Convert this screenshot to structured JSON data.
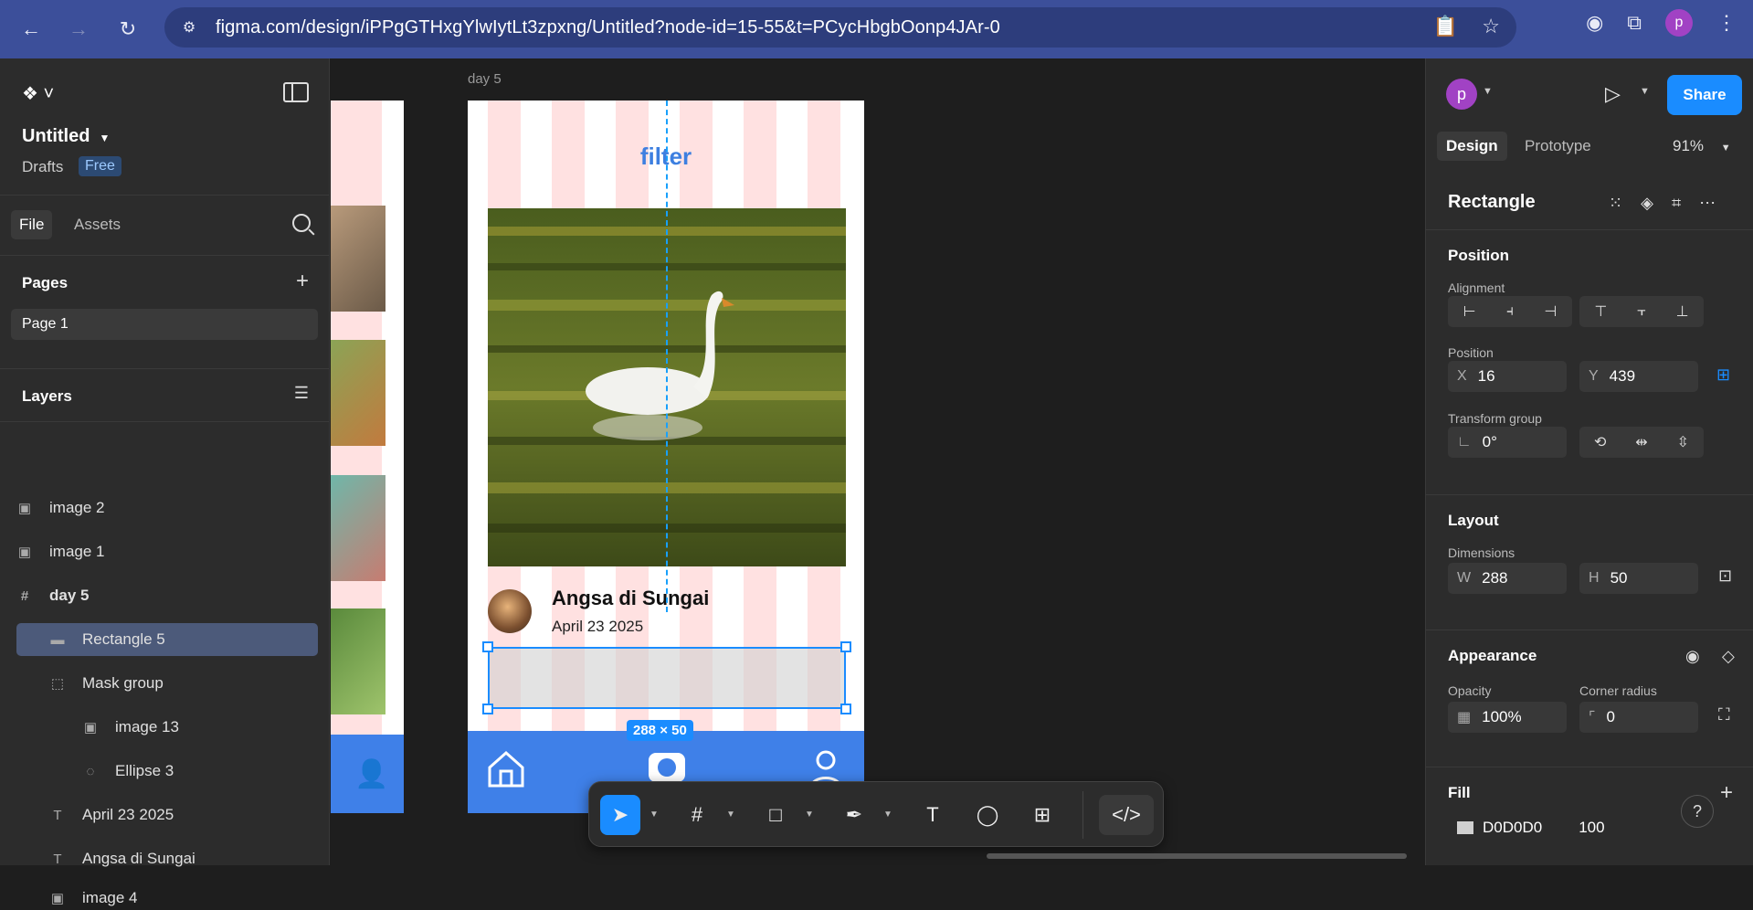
{
  "browser": {
    "url": "figma.com/design/iPPgGTHxgYlwIytLt3zpxng/Untitled?node-id=15-55&t=PCycHbgbOonp4JAr-0",
    "profile_initial": "p"
  },
  "left_panel": {
    "file_title": "Untitled",
    "drafts_label": "Drafts",
    "plan_badge": "Free",
    "tabs": [
      "File",
      "Assets"
    ],
    "pages_heading": "Pages",
    "pages": [
      "Page 1"
    ],
    "layers_heading": "Layers",
    "layers": [
      {
        "name": "image 2",
        "icon": "image-icon"
      },
      {
        "name": "image 1",
        "icon": "image-icon"
      },
      {
        "name": "day 5",
        "icon": "frame-icon"
      },
      {
        "name": "Rectangle 5",
        "icon": "rectangle-icon",
        "selected": true
      },
      {
        "name": "Mask group",
        "icon": "mask-icon"
      },
      {
        "name": "image 13",
        "icon": "image-icon"
      },
      {
        "name": "Ellipse 3",
        "icon": "ellipse-icon"
      },
      {
        "name": "April 23 2025",
        "icon": "text-icon"
      },
      {
        "name": "Angsa di Sungai",
        "icon": "text-icon"
      },
      {
        "name": "image 4",
        "icon": "image-icon"
      }
    ]
  },
  "canvas": {
    "frame_label": "day 5",
    "filter_text": "filter",
    "post_title": "Angsa di Sungai",
    "post_date": "April 23 2025",
    "selection_size": "288 × 50"
  },
  "right_panel": {
    "profile_initial": "p",
    "share_label": "Share",
    "tabs": [
      "Design",
      "Prototype"
    ],
    "zoom": "91%",
    "object_name": "Rectangle",
    "position_heading": "Position",
    "alignment_label": "Alignment",
    "position_label": "Position",
    "x_label": "X",
    "x_value": "16",
    "y_label": "Y",
    "y_value": "439",
    "transform_label": "Transform group",
    "rotation_value": "0°",
    "layout_heading": "Layout",
    "dimensions_label": "Dimensions",
    "w_label": "W",
    "w_value": "288",
    "h_label": "H",
    "h_value": "50",
    "appearance_heading": "Appearance",
    "opacity_label": "Opacity",
    "opacity_value": "100%",
    "radius_label": "Corner radius",
    "radius_value": "0",
    "fill_heading": "Fill",
    "fill_hex": "D0D0D0",
    "fill_opacity": "100"
  },
  "colors": {
    "accent": "#1a8cff",
    "chrome": "#3c4f9a",
    "frame_nav": "#3f80e8",
    "stripe": "#ffe1e1"
  }
}
